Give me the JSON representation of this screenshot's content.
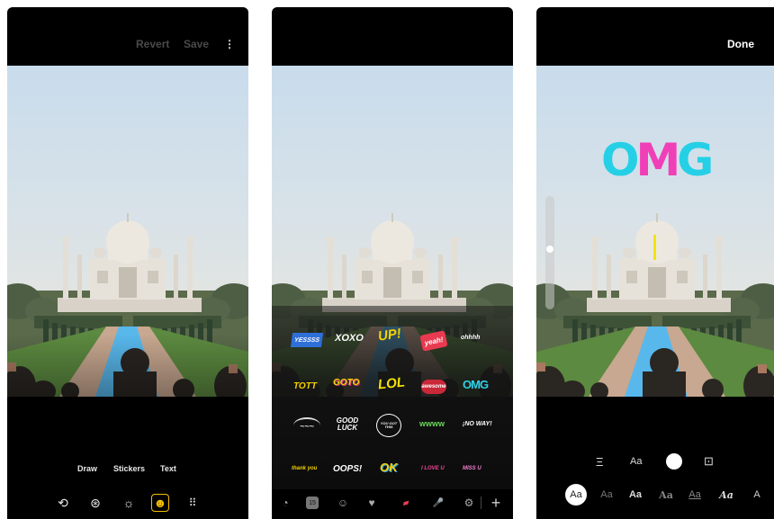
{
  "panel_1": {
    "topbar": {
      "revert": "Revert",
      "save": "Save",
      "more": "⋮"
    },
    "modes": {
      "draw": "Draw",
      "stickers": "Stickers",
      "text": "Text"
    },
    "tools": [
      {
        "name": "crop-rotate-icon",
        "glyph": "⟲"
      },
      {
        "name": "filters-icon",
        "glyph": "⊛"
      },
      {
        "name": "adjust-brightness-icon",
        "glyph": "☼"
      },
      {
        "name": "markup-sticker-icon",
        "glyph": "☻"
      },
      {
        "name": "more-tools-icon",
        "glyph": "⠿"
      }
    ]
  },
  "panel_2": {
    "stickers": [
      [
        "YESSSS",
        "XOXO",
        "UP!",
        "yeah!",
        "ohhhh"
      ],
      [
        "TOTT",
        "GOTO",
        "LOL",
        "awesome",
        "OMG"
      ],
      [
        "~~~",
        "GOOD LUCK",
        "YOU GOT THIS",
        "wwww",
        "¡NO WAY!"
      ],
      [
        "thank you",
        "OOPS!",
        "OK",
        "I LOVE U",
        "MISS U"
      ]
    ],
    "tray_icons": [
      {
        "name": "recent-icon",
        "glyph": "◔"
      },
      {
        "name": "calendar-icon",
        "glyph": "15"
      },
      {
        "name": "emoji-icon",
        "glyph": "☺"
      },
      {
        "name": "heart-icon",
        "glyph": "♥"
      },
      {
        "name": "text-sticker-icon",
        "glyph": "▰"
      },
      {
        "name": "microphone-icon",
        "glyph": "🎤"
      },
      {
        "name": "settings-icon",
        "glyph": "⚙"
      },
      {
        "name": "add-icon",
        "glyph": "+"
      }
    ]
  },
  "panel_3": {
    "topbar": {
      "done": "Done"
    },
    "overlay_text": {
      "o": "O",
      "m": "M",
      "g": "G",
      "colors": {
        "o": "#25d0e6",
        "m": "#f040b8",
        "g": "#25d0e6"
      }
    },
    "text_controls": {
      "align": "Ξ",
      "size": "Aa",
      "background": "⊡"
    },
    "fonts": [
      "Aa",
      "Aa",
      "Aa",
      "Aa",
      "Aa",
      "Aa",
      "A"
    ]
  },
  "colors": {
    "app_bg": "#000000",
    "accent_yellow": "#f4e400"
  }
}
